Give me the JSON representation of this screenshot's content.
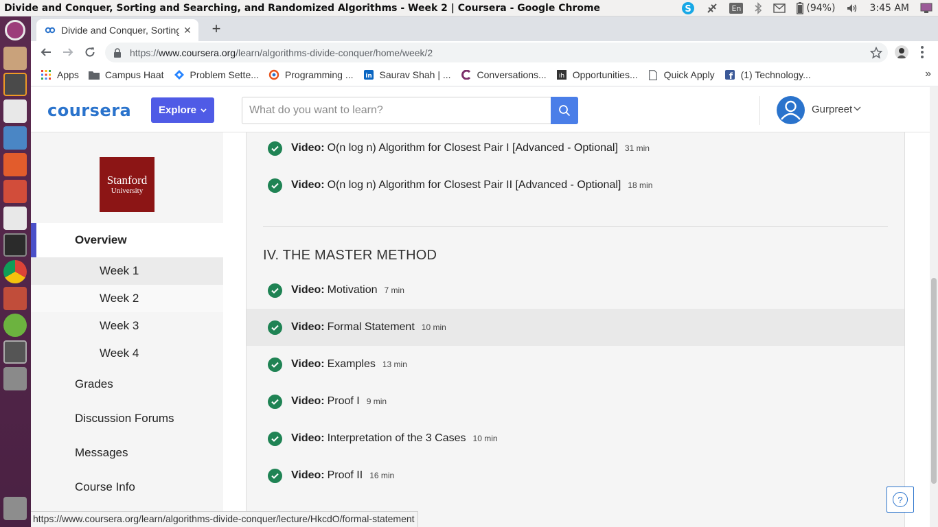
{
  "os": {
    "window_title": "Divide and Conquer, Sorting and Searching, and Randomized Algorithms - Week 2 | Coursera - Google Chrome",
    "keyboard": "En",
    "battery": "(94%)",
    "time": "3:45 AM"
  },
  "browser": {
    "tab_title": "Divide and Conquer, Sorting and Searching, and Randomized Algorithms - Week 2 | Coursera",
    "url_scheme": "https://",
    "url_host": "www.coursera.org",
    "url_path": "/learn/algorithms-divide-conquer/home/week/2",
    "bookmarks": [
      {
        "label": "Apps",
        "icon": "apps-grid-icon"
      },
      {
        "label": "Campus Haat",
        "icon": "folder-icon"
      },
      {
        "label": "Problem Sette...",
        "icon": "jira-icon"
      },
      {
        "label": "Programming ...",
        "icon": "hackerrank-icon"
      },
      {
        "label": "Saurav Shah | ...",
        "icon": "linkedin-icon"
      },
      {
        "label": "Conversations...",
        "icon": "chat-icon"
      },
      {
        "label": "Opportunities...",
        "icon": "ih-icon"
      },
      {
        "label": "Quick Apply",
        "icon": "page-icon"
      },
      {
        "label": "(1) Technology...",
        "icon": "facebook-icon"
      }
    ],
    "more_bookmarks": "»"
  },
  "header": {
    "logo": "coursera",
    "explore_label": "Explore",
    "search_placeholder": "What do you want to learn?",
    "user_name": "Gurpreet"
  },
  "sidebar": {
    "university_line1": "Stanford",
    "university_line2": "University",
    "overview": "Overview",
    "weeks": [
      "Week 1",
      "Week 2",
      "Week 3",
      "Week 4"
    ],
    "active_week": "Week 2",
    "links": [
      "Grades",
      "Discussion Forums",
      "Messages",
      "Course Info"
    ]
  },
  "content": {
    "prev_items": [
      {
        "kind": "Video:",
        "title": "O(n log n) Algorithm for Closest Pair I [Advanced - Optional]",
        "duration": "31 min"
      },
      {
        "kind": "Video:",
        "title": "O(n log n) Algorithm for Closest Pair II [Advanced - Optional]",
        "duration": "18 min"
      }
    ],
    "section_title": "IV. THE MASTER METHOD",
    "items": [
      {
        "kind": "Video:",
        "title": "Motivation",
        "duration": "7 min"
      },
      {
        "kind": "Video:",
        "title": "Formal Statement",
        "duration": "10 min"
      },
      {
        "kind": "Video:",
        "title": "Examples",
        "duration": "13 min"
      },
      {
        "kind": "Video:",
        "title": "Proof I",
        "duration": "9 min"
      },
      {
        "kind": "Video:",
        "title": "Interpretation of the 3 Cases",
        "duration": "10 min"
      },
      {
        "kind": "Video:",
        "title": "Proof II",
        "duration": "16 min"
      }
    ],
    "help_label": "?"
  },
  "status_url": "https://www.coursera.org/learn/algorithms-divide-conquer/lecture/HkcdO/formal-statement",
  "colors": {
    "brand": "#2a73cc",
    "explore": "#4f5be6",
    "check": "#1f8354",
    "university": "#8c1515"
  }
}
